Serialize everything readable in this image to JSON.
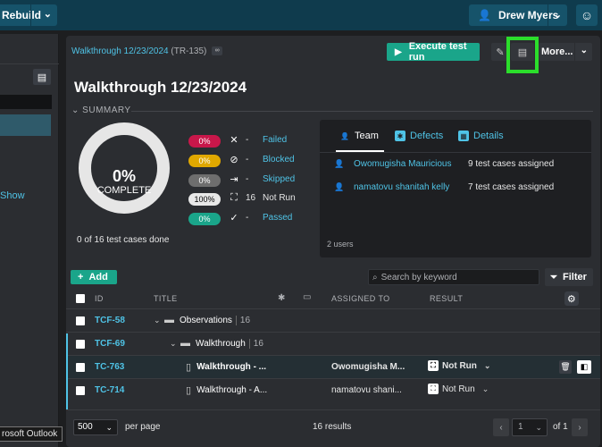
{
  "topbar": {
    "project_label": "Rebuild",
    "user_name": "Drew Myers"
  },
  "left_panel": {
    "show_label": "Show"
  },
  "header": {
    "breadcrumb_name": "Walkthrough 12/23/2024",
    "breadcrumb_code": "(TR-135)",
    "execute_label": "Execute test run",
    "more_label": "More..."
  },
  "title": "Walkthrough 12/23/2024",
  "summary": {
    "label": "SUMMARY",
    "complete_pct": "0%",
    "complete_label": "COMPLETE",
    "complete_fraction": 0,
    "done_text": "0 of 16 test cases done",
    "stats": [
      {
        "pct": "0%",
        "count": "-",
        "name": "Failed",
        "color": "#c8174a",
        "icon": "x-icon",
        "glyph": "✕"
      },
      {
        "pct": "0%",
        "count": "-",
        "name": "Blocked",
        "color": "#e0a800",
        "icon": "blocked-icon",
        "glyph": "⊘"
      },
      {
        "pct": "0%",
        "count": "-",
        "name": "Skipped",
        "color": "#6e6e6e",
        "icon": "skip-icon",
        "glyph": "⇥"
      },
      {
        "pct": "100%",
        "count": "16",
        "name": "Not Run",
        "color": "#e8e8e8",
        "icon": "not-run-icon",
        "glyph": "⛶"
      },
      {
        "pct": "0%",
        "count": "-",
        "name": "Passed",
        "color": "#1aa58a",
        "icon": "check-icon",
        "glyph": "✓"
      }
    ]
  },
  "team": {
    "tabs": [
      {
        "label": "Team",
        "icon": "user-icon"
      },
      {
        "label": "Defects",
        "icon": "bug-icon"
      },
      {
        "label": "Details",
        "icon": "details-icon"
      }
    ],
    "members": [
      {
        "name": "Owomugisha Mauricious",
        "assigned": "9 test cases assigned"
      },
      {
        "name": "namatovu shanitah kelly",
        "assigned": "7 test cases assigned"
      }
    ],
    "footer": "2 users"
  },
  "toolbar": {
    "add_label": "Add",
    "search_placeholder": "Search by keyword",
    "filter_label": "Filter"
  },
  "table": {
    "columns": {
      "id": "ID",
      "title": "TITLE",
      "assigned": "ASSIGNED TO",
      "result": "RESULT"
    },
    "rows": [
      {
        "id": "TCF-58",
        "title": "Observations",
        "count": "16",
        "kind": "folder"
      },
      {
        "id": "TCF-69",
        "title": "Walkthrough",
        "count": "16",
        "kind": "folder"
      },
      {
        "id": "TC-763",
        "title": "Walkthrough - ...",
        "assignee": "Owomugisha M...",
        "result": "Not Run",
        "kind": "case"
      },
      {
        "id": "TC-714",
        "title": "Walkthrough - A...",
        "assignee": "namatovu shani...",
        "result": "Not Run",
        "kind": "case"
      }
    ]
  },
  "footer": {
    "per_page_value": "500",
    "per_page_label": "per page",
    "results": "16 results",
    "page": "1",
    "of_pages": "of 1"
  },
  "tooltip": "rosoft Outlook"
}
